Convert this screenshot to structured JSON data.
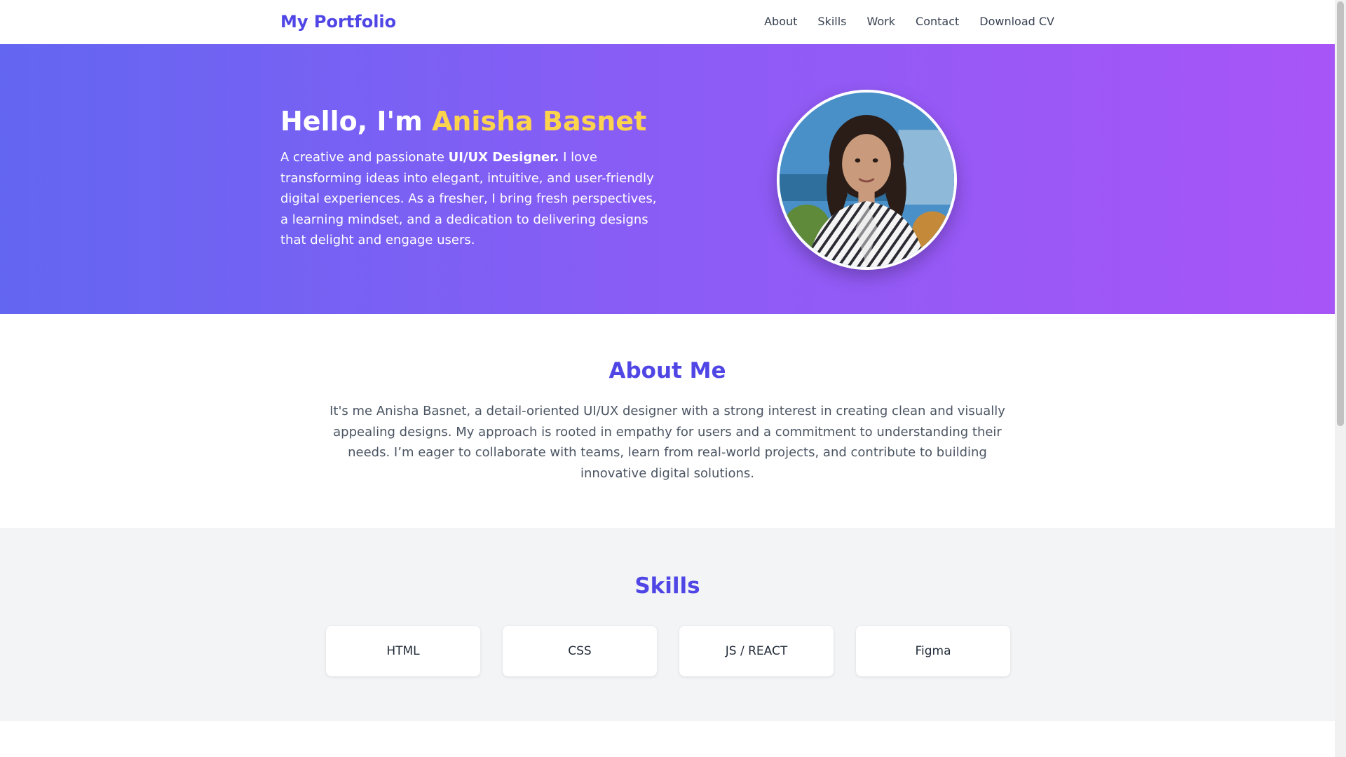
{
  "navbar": {
    "brand": "My Portfolio",
    "links": [
      "About",
      "Skills",
      "Work",
      "Contact",
      "Download CV"
    ]
  },
  "hero": {
    "greeting": "Hello, I'm ",
    "name": "Anisha Basnet",
    "intro_before": "A creative and passionate ",
    "intro_bold": "UI/UX Designer.",
    "intro_after": " I love transforming ideas into elegant, intuitive, and user-friendly digital experiences. As a fresher, I bring fresh perspectives, a learning mindset, and a dedication to delivering designs that delight and engage users.",
    "avatar_alt": "Anisha Basnet"
  },
  "about": {
    "title": "About Me",
    "text": "It's me Anisha Basnet, a detail-oriented UI/UX designer with a strong interest in creating clean and visually appealing designs. My approach is rooted in empathy for users and a commitment to understanding their needs. I’m eager to collaborate with teams, learn from real-world projects, and contribute to building innovative digital solutions."
  },
  "skills": {
    "title": "Skills",
    "items": [
      "HTML",
      "CSS",
      "JS / REACT",
      "Figma"
    ]
  },
  "colors": {
    "brand": "#4f46e5",
    "highlight": "#fcd34d",
    "hero_gradient_start": "#6366f1",
    "hero_gradient_end": "#a855f7"
  }
}
